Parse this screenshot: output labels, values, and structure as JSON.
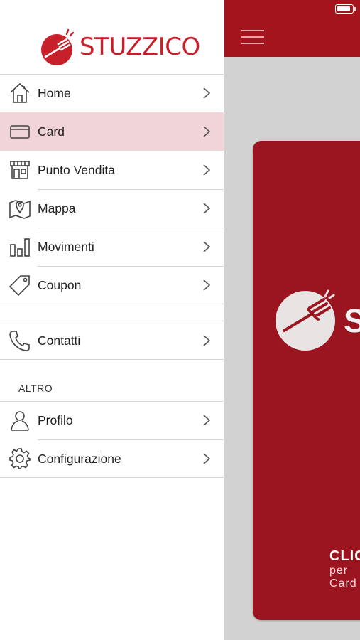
{
  "brand": {
    "name": "STUZZICO"
  },
  "menu": {
    "items": [
      {
        "label": "Home",
        "icon": "home-icon"
      },
      {
        "label": "Card",
        "icon": "card-icon",
        "active": true
      },
      {
        "label": "Punto Vendita",
        "icon": "store-icon"
      },
      {
        "label": "Mappa",
        "icon": "map-icon"
      },
      {
        "label": "Movimenti",
        "icon": "bar-chart-icon"
      },
      {
        "label": "Coupon",
        "icon": "tag-icon"
      }
    ],
    "contact": {
      "label": "Contatti",
      "icon": "phone-icon"
    },
    "section_title": "ALTRO",
    "other": [
      {
        "label": "Profilo",
        "icon": "user-icon"
      },
      {
        "label": "Configurazione",
        "icon": "gear-icon"
      }
    ]
  },
  "card": {
    "brand": "S",
    "line1": "CLIC",
    "line2": "per",
    "line3": "Card"
  },
  "colors": {
    "brand_red": "#c8202b",
    "header_red": "#a3141d",
    "card_red": "#9a1520",
    "active_bg": "#f1d4d7"
  },
  "status": {
    "battery_fraction": 0.9
  }
}
